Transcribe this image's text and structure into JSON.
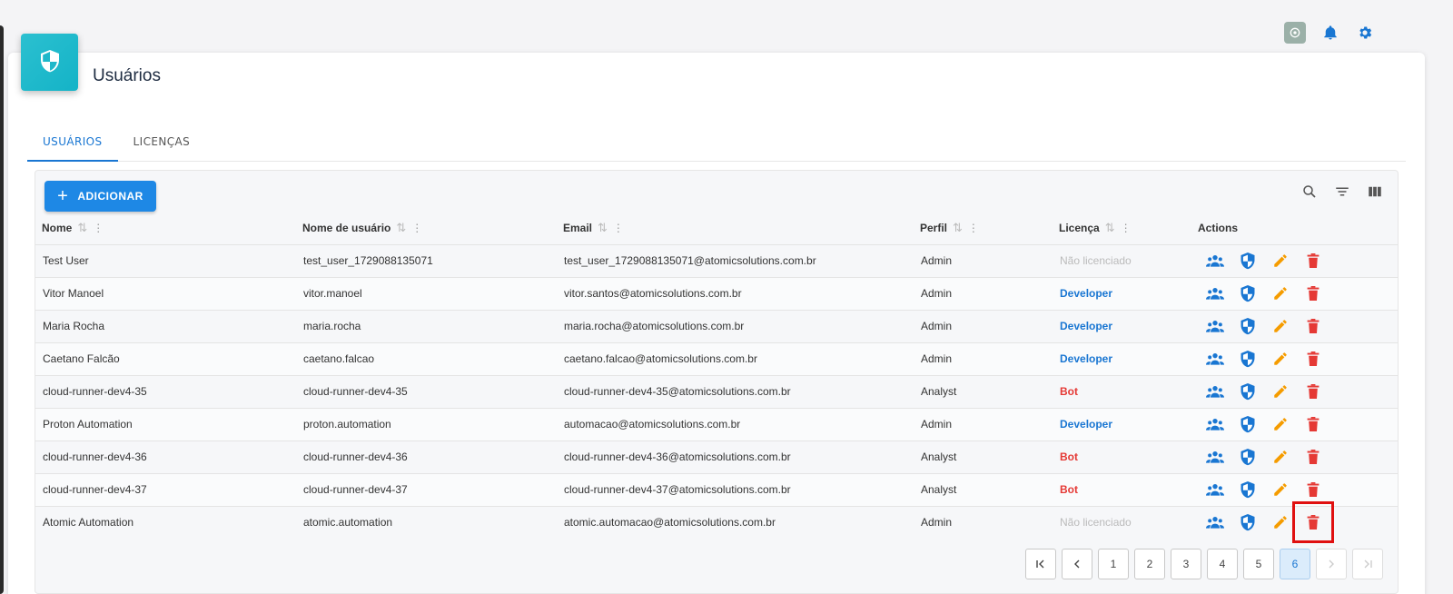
{
  "topbar": {
    "icons": [
      "ai-assistant-icon",
      "bell-icon",
      "gear-icon"
    ],
    "accent": "#1976d2"
  },
  "page": {
    "title": "Usuários",
    "badge_icon": "shield-icon",
    "badge_color": "#1fb8ca"
  },
  "tabs": [
    {
      "label": "USUÁRIOS",
      "active": true
    },
    {
      "label": "LICENÇAS",
      "active": false
    }
  ],
  "toolbar": {
    "add_label": "ADICIONAR",
    "tools": [
      "search-icon",
      "filter-icon",
      "columns-icon"
    ]
  },
  "table": {
    "headers": {
      "name": "Nome",
      "username": "Nome de usuário",
      "email": "Email",
      "profile": "Perfil",
      "license": "Licença",
      "actions": "Actions"
    },
    "rows": [
      {
        "name": "Test User",
        "username": "test_user_1729088135071",
        "email": "test_user_1729088135071@atomicsolutions.com.br",
        "profile": "Admin",
        "license": "Não licenciado",
        "license_type": "unlicensed"
      },
      {
        "name": "Vitor Manoel",
        "username": "vitor.manoel",
        "email": "vitor.santos@atomicsolutions.com.br",
        "profile": "Admin",
        "license": "Developer",
        "license_type": "developer"
      },
      {
        "name": "Maria Rocha",
        "username": "maria.rocha",
        "email": "maria.rocha@atomicsolutions.com.br",
        "profile": "Admin",
        "license": "Developer",
        "license_type": "developer"
      },
      {
        "name": "Caetano Falcão",
        "username": "caetano.falcao",
        "email": "caetano.falcao@atomicsolutions.com.br",
        "profile": "Admin",
        "license": "Developer",
        "license_type": "developer"
      },
      {
        "name": "cloud-runner-dev4-35",
        "username": "cloud-runner-dev4-35",
        "email": "cloud-runner-dev4-35@atomicsolutions.com.br",
        "profile": "Analyst",
        "license": "Bot",
        "license_type": "bot"
      },
      {
        "name": "Proton Automation",
        "username": "proton.automation",
        "email": "automacao@atomicsolutions.com.br",
        "profile": "Admin",
        "license": "Developer",
        "license_type": "developer"
      },
      {
        "name": "cloud-runner-dev4-36",
        "username": "cloud-runner-dev4-36",
        "email": "cloud-runner-dev4-36@atomicsolutions.com.br",
        "profile": "Analyst",
        "license": "Bot",
        "license_type": "bot"
      },
      {
        "name": "cloud-runner-dev4-37",
        "username": "cloud-runner-dev4-37",
        "email": "cloud-runner-dev4-37@atomicsolutions.com.br",
        "profile": "Analyst",
        "license": "Bot",
        "license_type": "bot"
      },
      {
        "name": "Atomic Automation",
        "username": "atomic.automation",
        "email": "atomic.automacao@atomicsolutions.com.br",
        "profile": "Admin",
        "license": "Não licenciado",
        "license_type": "unlicensed",
        "delete_highlighted": true
      }
    ],
    "row_actions": [
      "groups-icon",
      "shield-icon",
      "edit-icon",
      "delete-icon"
    ],
    "action_colors": {
      "groups": "#1976d2",
      "shield": "#1976d2",
      "edit": "#f59c00",
      "delete": "#e53935"
    }
  },
  "pagination": {
    "pages": [
      "1",
      "2",
      "3",
      "4",
      "5",
      "6"
    ],
    "current": "6"
  }
}
